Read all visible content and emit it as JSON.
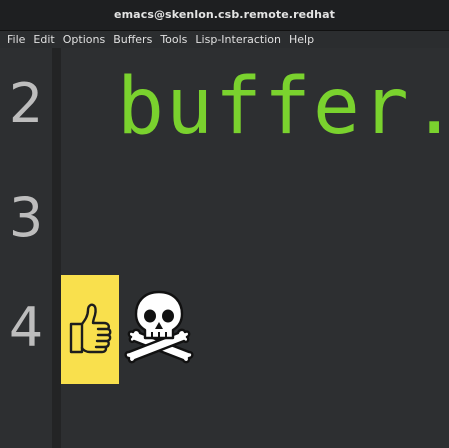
{
  "window": {
    "title": "emacs@skenlon.csb.remote.redhat"
  },
  "menu": {
    "items": [
      "File",
      "Edit",
      "Options",
      "Buffers",
      "Tools",
      "Lisp-Interaction",
      "Help"
    ]
  },
  "editor": {
    "line_numbers": [
      "2",
      "3",
      "4"
    ],
    "lines": {
      "line2": "buffer."
    },
    "emoji": {
      "thumbs_icon": "thumbs-up-icon",
      "skull_icon": "skull-crossbones-icon"
    }
  },
  "colors": {
    "code_text": "#7ad22e",
    "highlight": "#f9e04d",
    "background": "#2d2f31"
  }
}
